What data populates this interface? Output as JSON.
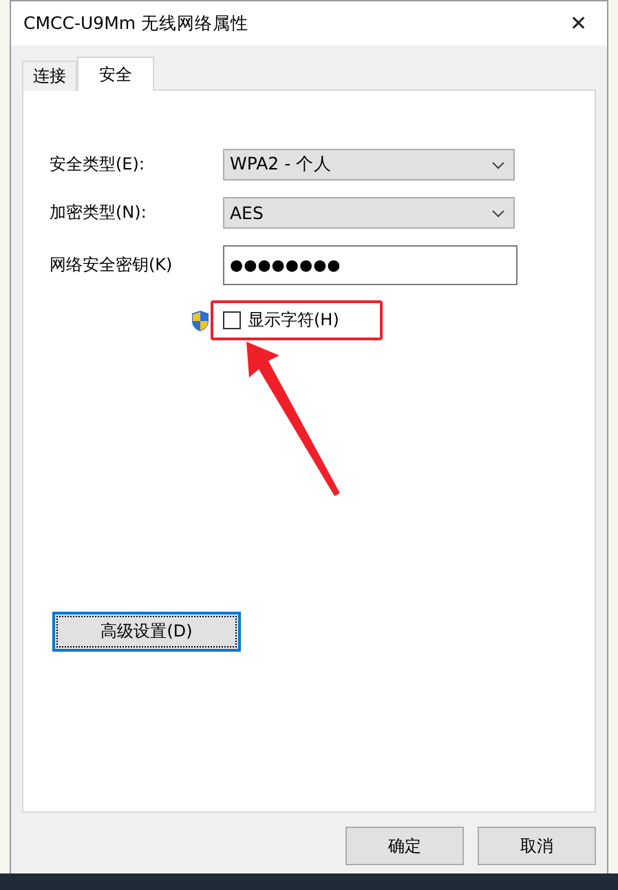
{
  "window": {
    "title": "CMCC-U9Mm 无线网络属性",
    "close": "✕"
  },
  "tabs": [
    {
      "label": "连接",
      "selected": false
    },
    {
      "label": "安全",
      "selected": true
    }
  ],
  "fields": [
    {
      "kind": "dropdown",
      "label": "安全类型(E):",
      "value": "WPA2 - 个人"
    },
    {
      "kind": "dropdown",
      "label": "加密类型(N):",
      "value": "AES"
    },
    {
      "kind": "password",
      "label": "网络安全密钥(K)",
      "value": "●●●●●●●●"
    }
  ],
  "show_characters": {
    "label": "显示字符(H)",
    "checked": false,
    "highlighted": true
  },
  "advanced_button": "高级设置(D)",
  "buttons": [
    "确定",
    "取消"
  ]
}
